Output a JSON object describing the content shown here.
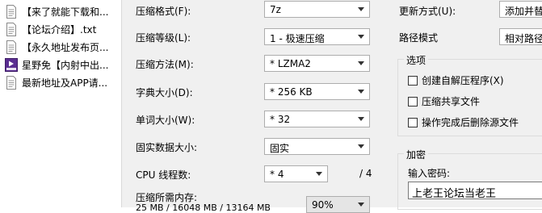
{
  "file_list": {
    "items": [
      {
        "label": "【来了就能下载和...",
        "icon": "text-file-icon"
      },
      {
        "label": "【论坛介绍】.txt",
        "icon": "text-file-icon"
      },
      {
        "label": "【永久地址发布页...",
        "icon": "text-file-icon"
      },
      {
        "label": "星野免【内射中出...",
        "icon": "media-file-icon"
      },
      {
        "label": "最新地址及APP请...",
        "icon": "text-file-icon"
      }
    ]
  },
  "form": {
    "format_label": "压缩格式(F):",
    "format_value": "7z",
    "level_label": "压缩等级(L):",
    "level_value": "1 - 极速压缩",
    "method_label": "压缩方法(M):",
    "method_value": "* LZMA2",
    "dict_label": "字典大小(D):",
    "dict_value": "* 256 KB",
    "word_label": "单词大小(W):",
    "word_value": "* 32",
    "solid_label": "固实数据大小:",
    "solid_value": "固实",
    "cpu_label": "CPU 线程数:",
    "cpu_value": "* 4",
    "cpu_total": "/ 4",
    "memory_label": "压缩所需内存:",
    "memory_detail": "25 MB / 16048 MB / 13164 MB",
    "memory_percent": "90%"
  },
  "right": {
    "update_label": "更新方式(U):",
    "update_value": "添加并替",
    "path_label": "路径模式",
    "path_value": "相对路径",
    "options_title": "选项",
    "options": [
      {
        "label": "创建自解压程序(X)",
        "checked": false
      },
      {
        "label": "压缩共享文件",
        "checked": false
      },
      {
        "label": "操作完成后删除源文件",
        "checked": false
      }
    ],
    "encrypt_title": "加密",
    "password_label": "输入密码:",
    "password_value": "上老王论坛当老王"
  },
  "colors": {
    "dialog_bg": "#f0f0f0",
    "media_icon": "#5a2d91"
  }
}
